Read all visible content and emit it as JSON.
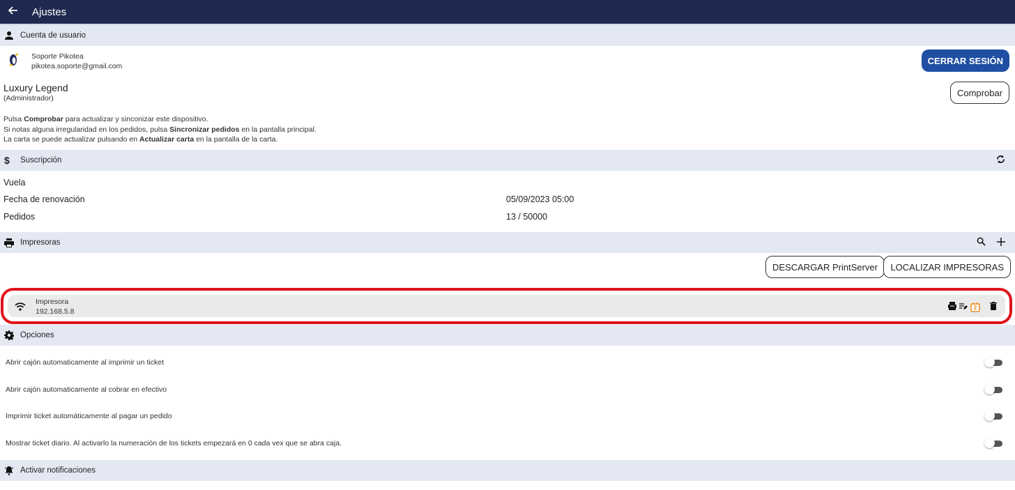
{
  "header": {
    "title": "Ajustes"
  },
  "account": {
    "section_title": "Cuenta de usuario",
    "user_name": "Soporte Pikotea",
    "user_email": "pikotea.soporte@gmail.com",
    "logout_label": "CERRAR SESIÓN",
    "business_name": "Luxury Legend",
    "role": "(Administrador)",
    "check_label": "Comprobar",
    "info": [
      {
        "pre": "Pulsa ",
        "bold": "Comprobar",
        "post": " para actualizar y sinconizar este dispositivo."
      },
      {
        "pre": "Si notas alguna irregularidad en los pedidos, pulsa ",
        "bold": "Sincronizar pedidos",
        "post": " en la pantalla principal."
      },
      {
        "pre": "La carta se puede actualizar pulsando en ",
        "bold": "Actualizar carta",
        "post": " en la pantalla de la carta."
      }
    ]
  },
  "subscription": {
    "section_title": "Suscripción",
    "plan": "Vuela",
    "renewal_label": "Fecha de renovación",
    "renewal_value": "05/09/2023 05:00",
    "orders_label": "Pedidos",
    "orders_value": "13 / 50000"
  },
  "printers": {
    "section_title": "Impresoras",
    "download_label": "DESCARGAR PrintServer",
    "locate_label": "LOCALIZAR IMPRESORAS",
    "items": [
      {
        "name": "Impresora",
        "ip": "192.168.5.8",
        "day_badge": "2"
      }
    ]
  },
  "options": {
    "section_title": "Opciones",
    "items": [
      {
        "label": "Abrir cajón automaticamente al imprimir un ticket",
        "enabled": false
      },
      {
        "label": "Abrir cajón automaticamente al cobrar en efectivo",
        "enabled": false
      },
      {
        "label": "Imprimir ticket automáticamente al pagar un pedido",
        "enabled": false
      },
      {
        "label": "Mostrar ticket diario. Al activarlo la numeración de los tickets empezará en 0 cada vex que se abra caja.",
        "enabled": false
      }
    ]
  },
  "notifications": {
    "section_title": "Activar notificaciones"
  },
  "colors": {
    "topbar": "#1e2a4f",
    "section_bg": "#e3e8f2",
    "primary": "#1f4ea3",
    "highlight": "#e0131b",
    "accent_orange": "#f08a24"
  },
  "icons": [
    "back-arrow-icon",
    "person-icon",
    "dollar-icon",
    "sync-icon",
    "printer-icon",
    "search-icon",
    "plus-icon",
    "wifi-icon",
    "receipt-printer-icon",
    "edit-list-icon",
    "calendar-icon",
    "trash-icon",
    "gear-icon",
    "bell-icon",
    "penguin-avatar"
  ]
}
